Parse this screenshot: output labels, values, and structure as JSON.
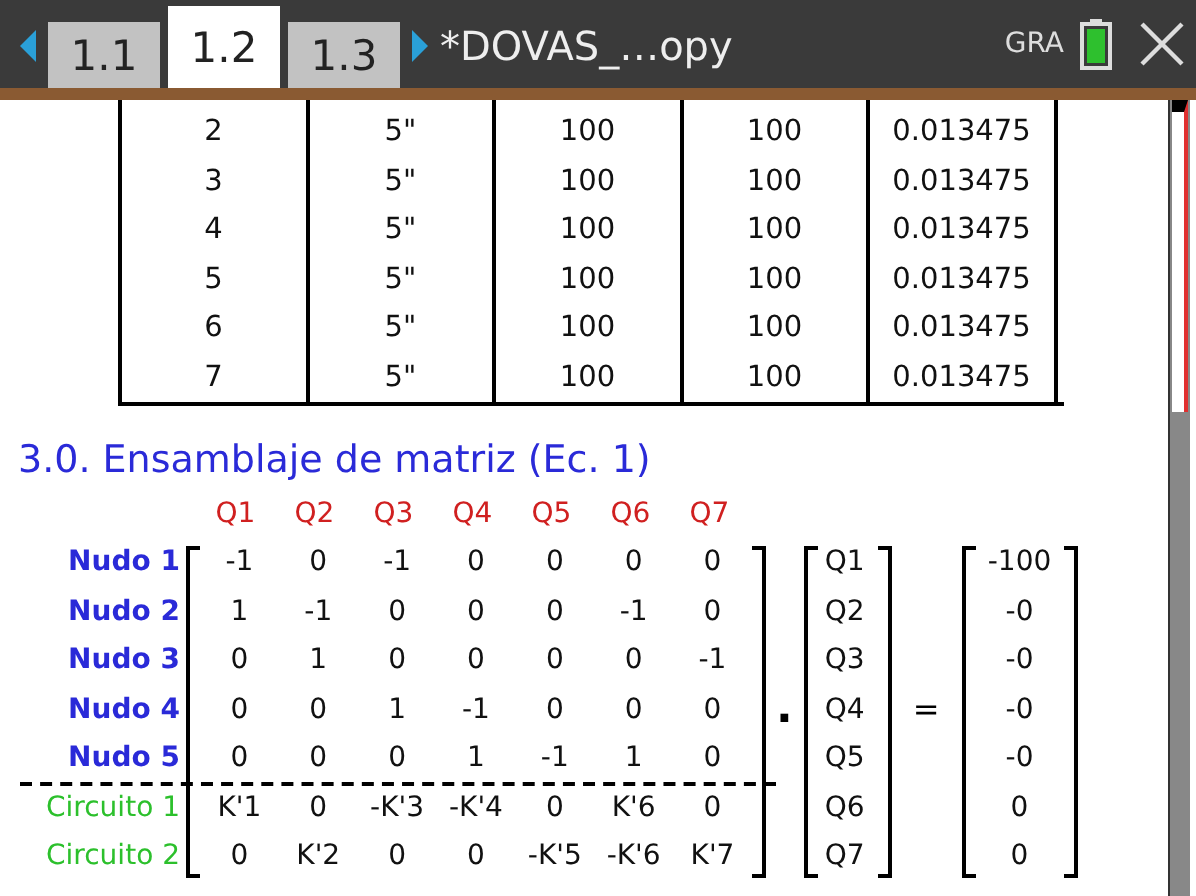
{
  "tabs": [
    {
      "label": "1.1",
      "selected": false
    },
    {
      "label": "1.2",
      "selected": true
    },
    {
      "label": "1.3",
      "selected": false
    }
  ],
  "document_title": "*DOVAS_…opy",
  "mode": "GRA",
  "table": {
    "rows": [
      {
        "column_1": "2",
        "column_2": "5\"",
        "column_3": "100",
        "column_4": "100",
        "column_5": "0.013475"
      },
      {
        "column_1": "3",
        "column_2": "5\"",
        "column_3": "100",
        "column_4": "100",
        "column_5": "0.013475"
      },
      {
        "column_1": "4",
        "column_2": "5\"",
        "column_3": "100",
        "column_4": "100",
        "column_5": "0.013475"
      },
      {
        "column_1": "5",
        "column_2": "5\"",
        "column_3": "100",
        "column_4": "100",
        "column_5": "0.013475"
      },
      {
        "column_1": "6",
        "column_2": "5\"",
        "column_3": "100",
        "column_4": "100",
        "column_5": "0.013475"
      },
      {
        "column_1": "7",
        "column_2": "5\"",
        "column_3": "100",
        "column_4": "100",
        "column_5": "0.013475"
      }
    ]
  },
  "heading": "3.0. Ensamblaje de matriz (Ec. 1)",
  "matrix": {
    "column_headers": [
      "Q1",
      "Q2",
      "Q3",
      "Q4",
      "Q5",
      "Q6",
      "Q7"
    ],
    "rows": [
      {
        "label": "Nudo 1",
        "kind": "nudo",
        "cells": [
          "-1",
          "0",
          "-1",
          "0",
          "0",
          "0",
          "0"
        ]
      },
      {
        "label": "Nudo 2",
        "kind": "nudo",
        "cells": [
          "1",
          "-1",
          "0",
          "0",
          "0",
          "-1",
          "0"
        ]
      },
      {
        "label": "Nudo 3",
        "kind": "nudo",
        "cells": [
          "0",
          "1",
          "0",
          "0",
          "0",
          "0",
          "-1"
        ]
      },
      {
        "label": "Nudo 4",
        "kind": "nudo",
        "cells": [
          "0",
          "0",
          "1",
          "-1",
          "0",
          "0",
          "0"
        ]
      },
      {
        "label": "Nudo 5",
        "kind": "nudo",
        "cells": [
          "0",
          "0",
          "0",
          "1",
          "-1",
          "1",
          "0"
        ]
      },
      {
        "label": "Circuito 1",
        "kind": "circuito",
        "cells": [
          "K'1",
          "0",
          "-K'3",
          "-K'4",
          "0",
          "K'6",
          "0"
        ]
      },
      {
        "label": "Circuito 2",
        "kind": "circuito",
        "cells": [
          "0",
          "K'2",
          "0",
          "0",
          "-K'5",
          "-K'6",
          "K'7"
        ]
      }
    ],
    "operator": ".",
    "vector": [
      "Q1",
      "Q2",
      "Q3",
      "Q4",
      "Q5",
      "Q6",
      "Q7"
    ],
    "equals": "=",
    "result": [
      "-100",
      "-0",
      "-0",
      "-0",
      "-0",
      "0",
      "0"
    ]
  }
}
